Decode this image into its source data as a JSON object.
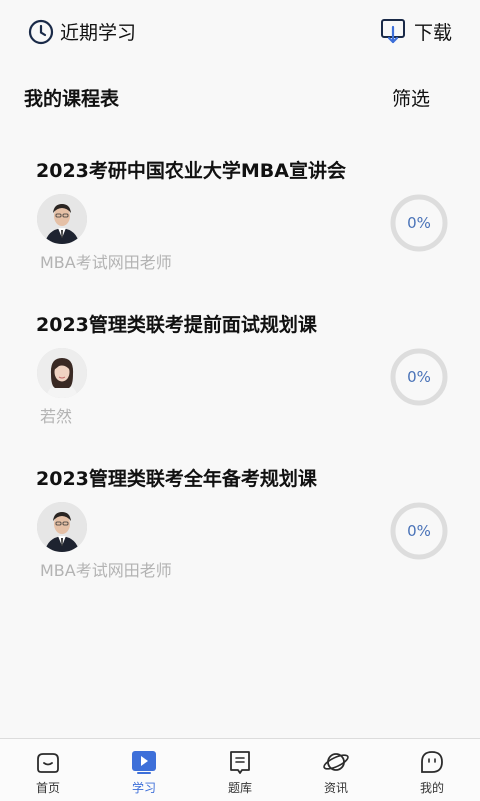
{
  "header": {
    "recent_label": "近期学习",
    "download_label": "下载"
  },
  "section": {
    "title": "我的课程表",
    "filter_label": "筛选"
  },
  "courses": [
    {
      "title": "2023考研中国农业大学MBA宣讲会",
      "teacher": "MBA考试网田老师",
      "progress_text": "0%",
      "progress": 0,
      "avatar": "male-teacher-avatar"
    },
    {
      "title": "2023管理类联考提前面试规划课",
      "teacher": "若然",
      "progress_text": "0%",
      "progress": 0,
      "avatar": "female-teacher-avatar"
    },
    {
      "title": "2023管理类联考全年备考规划课",
      "teacher": "MBA考试网田老师",
      "progress_text": "0%",
      "progress": 0,
      "avatar": "male-teacher-avatar"
    }
  ],
  "tabs": [
    {
      "label": "首页",
      "icon": "home-icon",
      "active": false
    },
    {
      "label": "学习",
      "icon": "play-icon",
      "active": true
    },
    {
      "label": "题库",
      "icon": "book-icon",
      "active": false
    },
    {
      "label": "资讯",
      "icon": "planet-icon",
      "active": false
    },
    {
      "label": "我的",
      "icon": "profile-icon",
      "active": false
    }
  ],
  "colors": {
    "accent": "#3d6fd9",
    "progress_text": "#4a73b8",
    "progress_ring": "#dddddd",
    "muted_text": "#b3b3b3"
  }
}
